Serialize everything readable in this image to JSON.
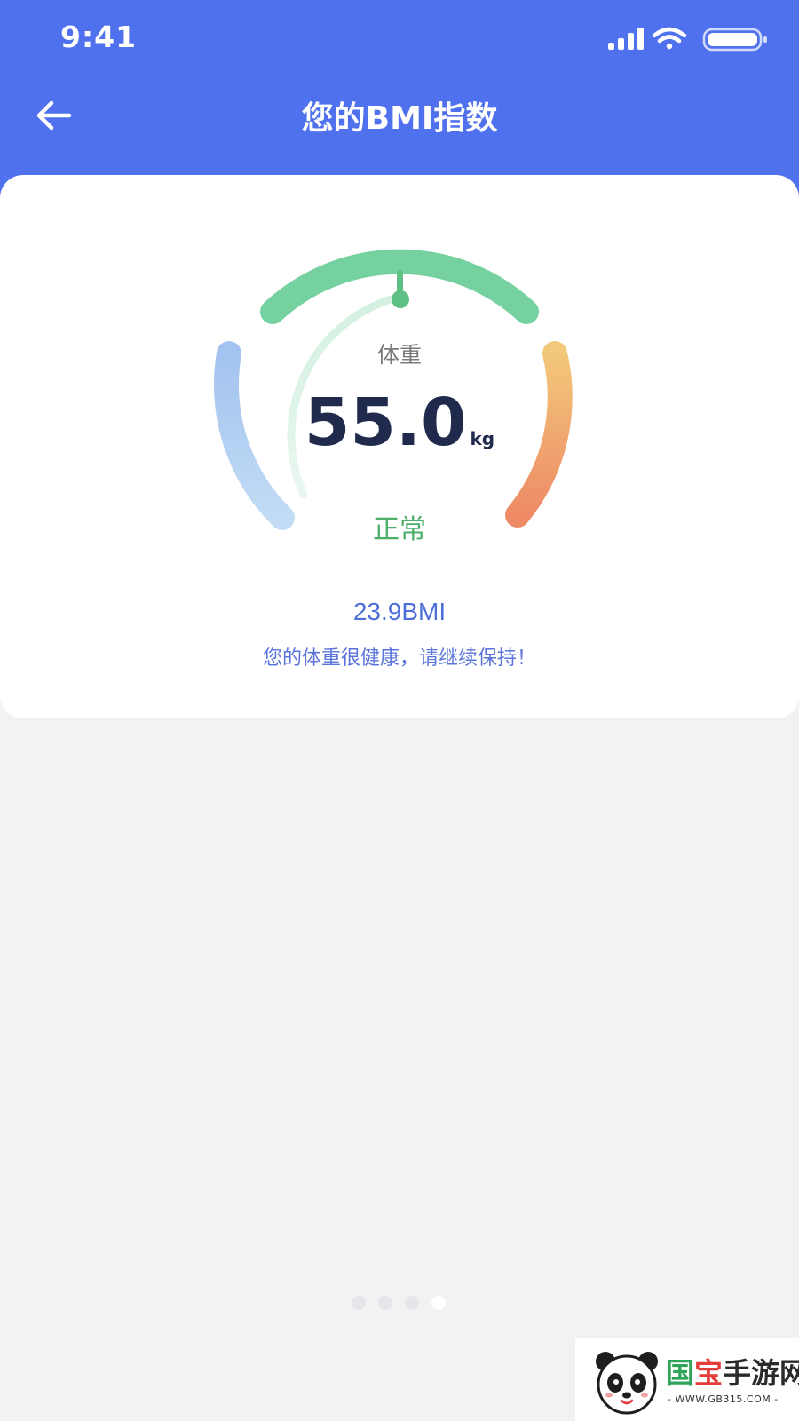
{
  "status_bar": {
    "time": "9:41",
    "icons": [
      "signal-icon",
      "wifi-icon",
      "battery-icon"
    ]
  },
  "header": {
    "title": "您的BMI指数",
    "back_icon": "back-arrow-icon"
  },
  "bmi_card": {
    "weight_label": "体重",
    "weight_value": "55.0",
    "weight_unit": "kg",
    "status": "正常",
    "bmi_value": "23.9BMI",
    "advice": "您的体重很健康，请继续保持！"
  },
  "gauge": {
    "segments": [
      "underweight",
      "normal",
      "overweight"
    ],
    "colors": {
      "underweight_start": "#c2dcf5",
      "underweight_end": "#a3c3f0",
      "normal": "#76d1a0",
      "overweight_start": "#f2c87a",
      "overweight_end": "#ee8a66"
    }
  },
  "pager": {
    "count": 4,
    "active_index": 3
  },
  "watermark": {
    "title_part1": "国",
    "title_part2": "宝",
    "title_part3": "手游网",
    "url": "- WWW.GB315.COM -"
  },
  "colors": {
    "header_bg": "#5071ee",
    "page_bg": "#f2f2f3",
    "card_bg": "#ffffff",
    "weight_text": "#1f2a4d",
    "status_green": "#4caf6a",
    "bmi_blue": "#4c6fd9"
  }
}
